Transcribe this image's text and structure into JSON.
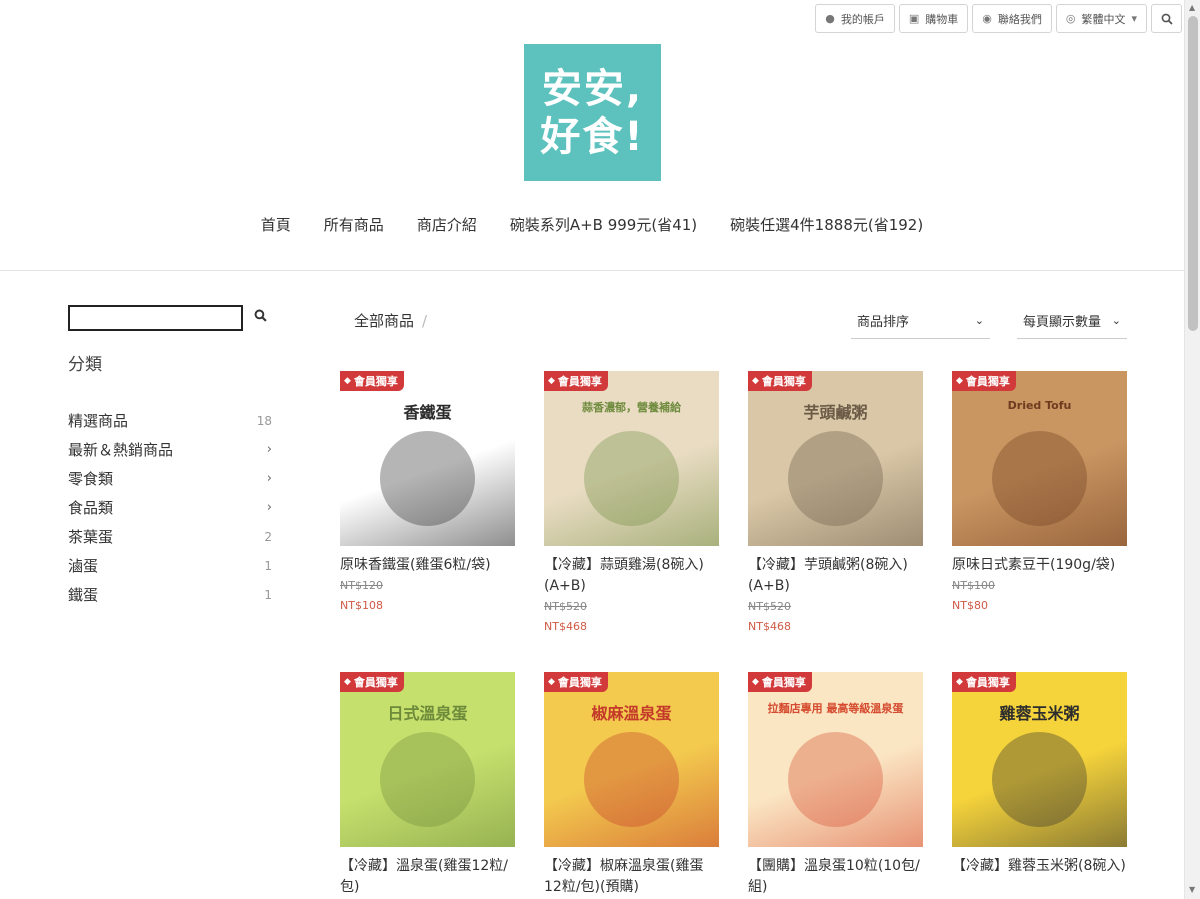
{
  "topbar": {
    "account": "我的帳戶",
    "cart": "購物車",
    "contact": "聯絡我們",
    "language": "繁體中文"
  },
  "logo": {
    "line1": "安安,",
    "line2": "好食!"
  },
  "nav": [
    "首頁",
    "所有商品",
    "商店介紹",
    "碗裝系列A+B 999元(省41)",
    "碗裝任選4件1888元(省192)"
  ],
  "sidebar": {
    "title": "分類",
    "categories": [
      {
        "label": "精選商品",
        "count": "18",
        "chevron": false
      },
      {
        "label": "最新＆熱銷商品",
        "count": "",
        "chevron": true
      },
      {
        "label": "零食類",
        "count": "",
        "chevron": true
      },
      {
        "label": "食品類",
        "count": "",
        "chevron": true
      },
      {
        "label": "茶葉蛋",
        "count": "2",
        "chevron": false
      },
      {
        "label": "滷蛋",
        "count": "1",
        "chevron": false
      },
      {
        "label": "鐵蛋",
        "count": "1",
        "chevron": false
      }
    ]
  },
  "toolbar": {
    "breadcrumb": "全部商品",
    "sort_label": "商品排序",
    "perpage_label": "每頁顯示數量"
  },
  "badge_label": "會員獨享",
  "products": [
    {
      "name": "原味香鐵蛋(雞蛋6粒/袋)",
      "old_price": "NT$120",
      "new_price": "NT$108",
      "image_text": "香鐵蛋",
      "colors": [
        "#ffffff",
        "#2b2b2b"
      ]
    },
    {
      "name": "【冷藏】蒜頭雞湯(8碗入)(A+B)",
      "old_price": "NT$520",
      "new_price": "NT$468",
      "image_text": "蒜香濃郁，營養補給",
      "colors": [
        "#e9dcc3",
        "#6f8b3e"
      ]
    },
    {
      "name": "【冷藏】芋頭鹹粥(8碗入)(A+B)",
      "old_price": "NT$520",
      "new_price": "NT$468",
      "image_text": "芋頭鹹粥",
      "colors": [
        "#d9c7a7",
        "#6b5a46"
      ]
    },
    {
      "name": "原味日式素豆干(190g/袋)",
      "old_price": "NT$100",
      "new_price": "NT$80",
      "image_text": "Dried Tofu",
      "colors": [
        "#c99561",
        "#6e3b1f"
      ]
    },
    {
      "name": "【冷藏】溫泉蛋(雞蛋12粒/包)",
      "old_price": "",
      "new_price": "",
      "image_text": "日式溫泉蛋",
      "colors": [
        "#c6e06d",
        "#6c8a3a"
      ]
    },
    {
      "name": "【冷藏】椒麻溫泉蛋(雞蛋12粒/包)(預購)",
      "old_price": "",
      "new_price": "",
      "image_text": "椒麻溫泉蛋",
      "colors": [
        "#f3c94e",
        "#c43a2a"
      ]
    },
    {
      "name": "【團購】溫泉蛋10粒(10包/組)",
      "old_price": "",
      "new_price": "",
      "image_text": "拉麵店專用 最高等級溫泉蛋",
      "colors": [
        "#fbe6c4",
        "#d54b2f"
      ]
    },
    {
      "name": "【冷藏】雞蓉玉米粥(8碗入)",
      "old_price": "",
      "new_price": "",
      "image_text": "雞蓉玉米粥",
      "colors": [
        "#f5d33b",
        "#2d2d2d"
      ]
    }
  ]
}
